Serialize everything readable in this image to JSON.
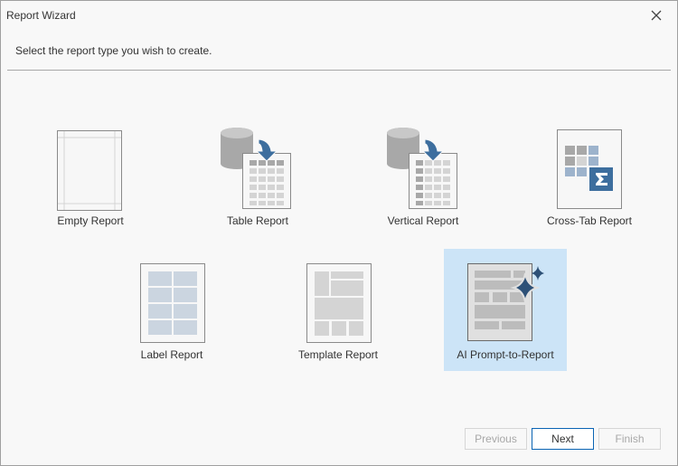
{
  "window": {
    "title": "Report Wizard",
    "close_icon": "close-icon"
  },
  "subtitle": "Select the report type you wish to create.",
  "report_types": [
    {
      "label": "Empty Report",
      "icon": "empty-report-icon"
    },
    {
      "label": "Table Report",
      "icon": "table-report-icon"
    },
    {
      "label": "Vertical Report",
      "icon": "vertical-report-icon"
    },
    {
      "label": "Cross-Tab Report",
      "icon": "cross-tab-report-icon"
    },
    {
      "label": "Label Report",
      "icon": "label-report-icon"
    },
    {
      "label": "Template Report",
      "icon": "template-report-icon"
    },
    {
      "label": "AI Prompt-to-Report",
      "icon": "ai-sparkle-report-icon",
      "selected": true
    }
  ],
  "buttons": {
    "previous": "Previous",
    "next": "Next",
    "finish": "Finish"
  },
  "colors": {
    "accent": "#0a64b4",
    "selection": "#cce4f7",
    "icon_blue": "#3d6e9e",
    "sparkle": "#2e5177"
  }
}
